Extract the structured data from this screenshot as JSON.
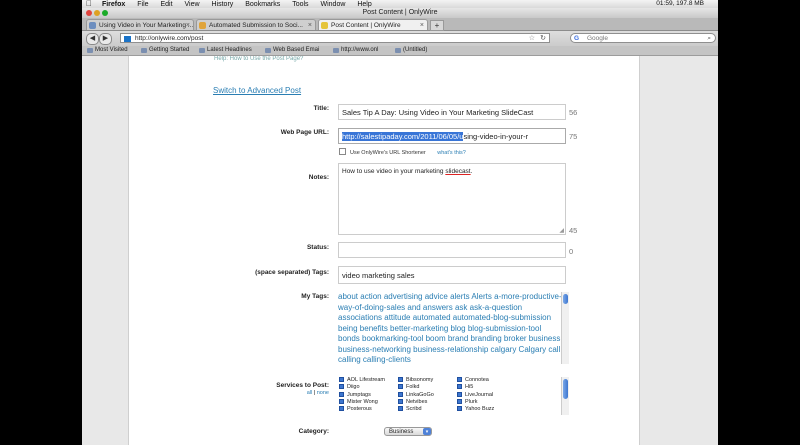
{
  "menubar": {
    "items": [
      "Firefox",
      "File",
      "Edit",
      "View",
      "History",
      "Bookmarks",
      "Tools",
      "Window",
      "Help"
    ],
    "status": "01:59, 197.8 MB"
  },
  "window": {
    "title": "Post Content | OnlyWire"
  },
  "tabs": [
    {
      "label": "Using Video in Your Marketing ..."
    },
    {
      "label": "Automated Submission to Soci..."
    },
    {
      "label": "Post Content | OnlyWire"
    }
  ],
  "nav": {
    "url": "http://onlywire.com/post",
    "search_placeholder": "Google"
  },
  "bookmarks": [
    "Most Visited",
    "Getting Started",
    "Latest Headlines",
    "Web Based Emai",
    "http://www.onl",
    "(Untitled)"
  ],
  "form": {
    "cutoff_text": "Help: How to Use the Post Page?",
    "switch_link": "Switch to Advanced Post",
    "title_label": "Title:",
    "title_value": "Sales Tip A Day: Using Video in Your Marketing SlideCast",
    "title_count": "56",
    "url_label": "Web Page URL:",
    "url_selected": "http://salestipaday.com/2011/06/05/u",
    "url_rest": "sing-video-in-your-r",
    "url_count": "75",
    "shortener_label": "Use OnlyWire's URL Shortener",
    "whats_this": "what's this?",
    "notes_label": "Notes:",
    "notes_value": "How to use video in your marketing ",
    "notes_underlined": "slidecast",
    "notes_end": ".",
    "notes_count": "45",
    "status_label": "Status:",
    "status_count": "0",
    "tags_label": "(space separated) Tags:",
    "tags_value": "video marketing sales",
    "mytags_label": "My Tags:",
    "mytags": "about action advertising advice alerts Alerts a-more-productive-way-of-doing-sales and answers ask ask-a-question associations attitude automated automated-blog-submission being benefits better-marketing blog blog-submission-tool bonds bookmarking-tool boom brand branding broker business business-networking business-relationship calgary Calgary call calling calling-clients",
    "services_label": "Services to Post:",
    "all_link": "all",
    "none_link": "none",
    "services_col1": [
      "AOL Lifestream",
      "Diigo",
      "Jumptags",
      "Mister Wong",
      "Posterous"
    ],
    "services_col2": [
      "Bibsonomy",
      "Folkd",
      "LinkaGoGo",
      "Netvibes",
      "Scribd"
    ],
    "services_col3": [
      "Connotea",
      "Hi5",
      "LiveJournal",
      "Plurk",
      "Yahoo Buzz"
    ],
    "category_label": "Category:",
    "category_value": "Business"
  },
  "colors": {
    "link": "#2a7eb3",
    "selection": "#3875d7"
  }
}
